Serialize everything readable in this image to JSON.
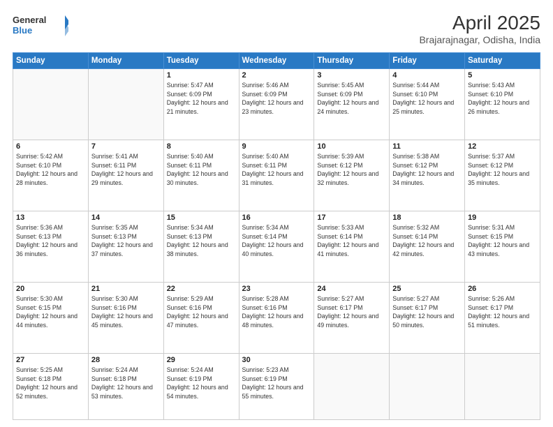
{
  "logo": {
    "line1": "General",
    "line2": "Blue"
  },
  "title": "April 2025",
  "location": "Brajarajnagar, Odisha, India",
  "days_of_week": [
    "Sunday",
    "Monday",
    "Tuesday",
    "Wednesday",
    "Thursday",
    "Friday",
    "Saturday"
  ],
  "weeks": [
    [
      {
        "day": null,
        "info": null
      },
      {
        "day": null,
        "info": null
      },
      {
        "day": "1",
        "info": "Sunrise: 5:47 AM\nSunset: 6:09 PM\nDaylight: 12 hours and 21 minutes."
      },
      {
        "day": "2",
        "info": "Sunrise: 5:46 AM\nSunset: 6:09 PM\nDaylight: 12 hours and 23 minutes."
      },
      {
        "day": "3",
        "info": "Sunrise: 5:45 AM\nSunset: 6:09 PM\nDaylight: 12 hours and 24 minutes."
      },
      {
        "day": "4",
        "info": "Sunrise: 5:44 AM\nSunset: 6:10 PM\nDaylight: 12 hours and 25 minutes."
      },
      {
        "day": "5",
        "info": "Sunrise: 5:43 AM\nSunset: 6:10 PM\nDaylight: 12 hours and 26 minutes."
      }
    ],
    [
      {
        "day": "6",
        "info": "Sunrise: 5:42 AM\nSunset: 6:10 PM\nDaylight: 12 hours and 28 minutes."
      },
      {
        "day": "7",
        "info": "Sunrise: 5:41 AM\nSunset: 6:11 PM\nDaylight: 12 hours and 29 minutes."
      },
      {
        "day": "8",
        "info": "Sunrise: 5:40 AM\nSunset: 6:11 PM\nDaylight: 12 hours and 30 minutes."
      },
      {
        "day": "9",
        "info": "Sunrise: 5:40 AM\nSunset: 6:11 PM\nDaylight: 12 hours and 31 minutes."
      },
      {
        "day": "10",
        "info": "Sunrise: 5:39 AM\nSunset: 6:12 PM\nDaylight: 12 hours and 32 minutes."
      },
      {
        "day": "11",
        "info": "Sunrise: 5:38 AM\nSunset: 6:12 PM\nDaylight: 12 hours and 34 minutes."
      },
      {
        "day": "12",
        "info": "Sunrise: 5:37 AM\nSunset: 6:12 PM\nDaylight: 12 hours and 35 minutes."
      }
    ],
    [
      {
        "day": "13",
        "info": "Sunrise: 5:36 AM\nSunset: 6:13 PM\nDaylight: 12 hours and 36 minutes."
      },
      {
        "day": "14",
        "info": "Sunrise: 5:35 AM\nSunset: 6:13 PM\nDaylight: 12 hours and 37 minutes."
      },
      {
        "day": "15",
        "info": "Sunrise: 5:34 AM\nSunset: 6:13 PM\nDaylight: 12 hours and 38 minutes."
      },
      {
        "day": "16",
        "info": "Sunrise: 5:34 AM\nSunset: 6:14 PM\nDaylight: 12 hours and 40 minutes."
      },
      {
        "day": "17",
        "info": "Sunrise: 5:33 AM\nSunset: 6:14 PM\nDaylight: 12 hours and 41 minutes."
      },
      {
        "day": "18",
        "info": "Sunrise: 5:32 AM\nSunset: 6:14 PM\nDaylight: 12 hours and 42 minutes."
      },
      {
        "day": "19",
        "info": "Sunrise: 5:31 AM\nSunset: 6:15 PM\nDaylight: 12 hours and 43 minutes."
      }
    ],
    [
      {
        "day": "20",
        "info": "Sunrise: 5:30 AM\nSunset: 6:15 PM\nDaylight: 12 hours and 44 minutes."
      },
      {
        "day": "21",
        "info": "Sunrise: 5:30 AM\nSunset: 6:16 PM\nDaylight: 12 hours and 45 minutes."
      },
      {
        "day": "22",
        "info": "Sunrise: 5:29 AM\nSunset: 6:16 PM\nDaylight: 12 hours and 47 minutes."
      },
      {
        "day": "23",
        "info": "Sunrise: 5:28 AM\nSunset: 6:16 PM\nDaylight: 12 hours and 48 minutes."
      },
      {
        "day": "24",
        "info": "Sunrise: 5:27 AM\nSunset: 6:17 PM\nDaylight: 12 hours and 49 minutes."
      },
      {
        "day": "25",
        "info": "Sunrise: 5:27 AM\nSunset: 6:17 PM\nDaylight: 12 hours and 50 minutes."
      },
      {
        "day": "26",
        "info": "Sunrise: 5:26 AM\nSunset: 6:17 PM\nDaylight: 12 hours and 51 minutes."
      }
    ],
    [
      {
        "day": "27",
        "info": "Sunrise: 5:25 AM\nSunset: 6:18 PM\nDaylight: 12 hours and 52 minutes."
      },
      {
        "day": "28",
        "info": "Sunrise: 5:24 AM\nSunset: 6:18 PM\nDaylight: 12 hours and 53 minutes."
      },
      {
        "day": "29",
        "info": "Sunrise: 5:24 AM\nSunset: 6:19 PM\nDaylight: 12 hours and 54 minutes."
      },
      {
        "day": "30",
        "info": "Sunrise: 5:23 AM\nSunset: 6:19 PM\nDaylight: 12 hours and 55 minutes."
      },
      {
        "day": null,
        "info": null
      },
      {
        "day": null,
        "info": null
      },
      {
        "day": null,
        "info": null
      }
    ]
  ]
}
